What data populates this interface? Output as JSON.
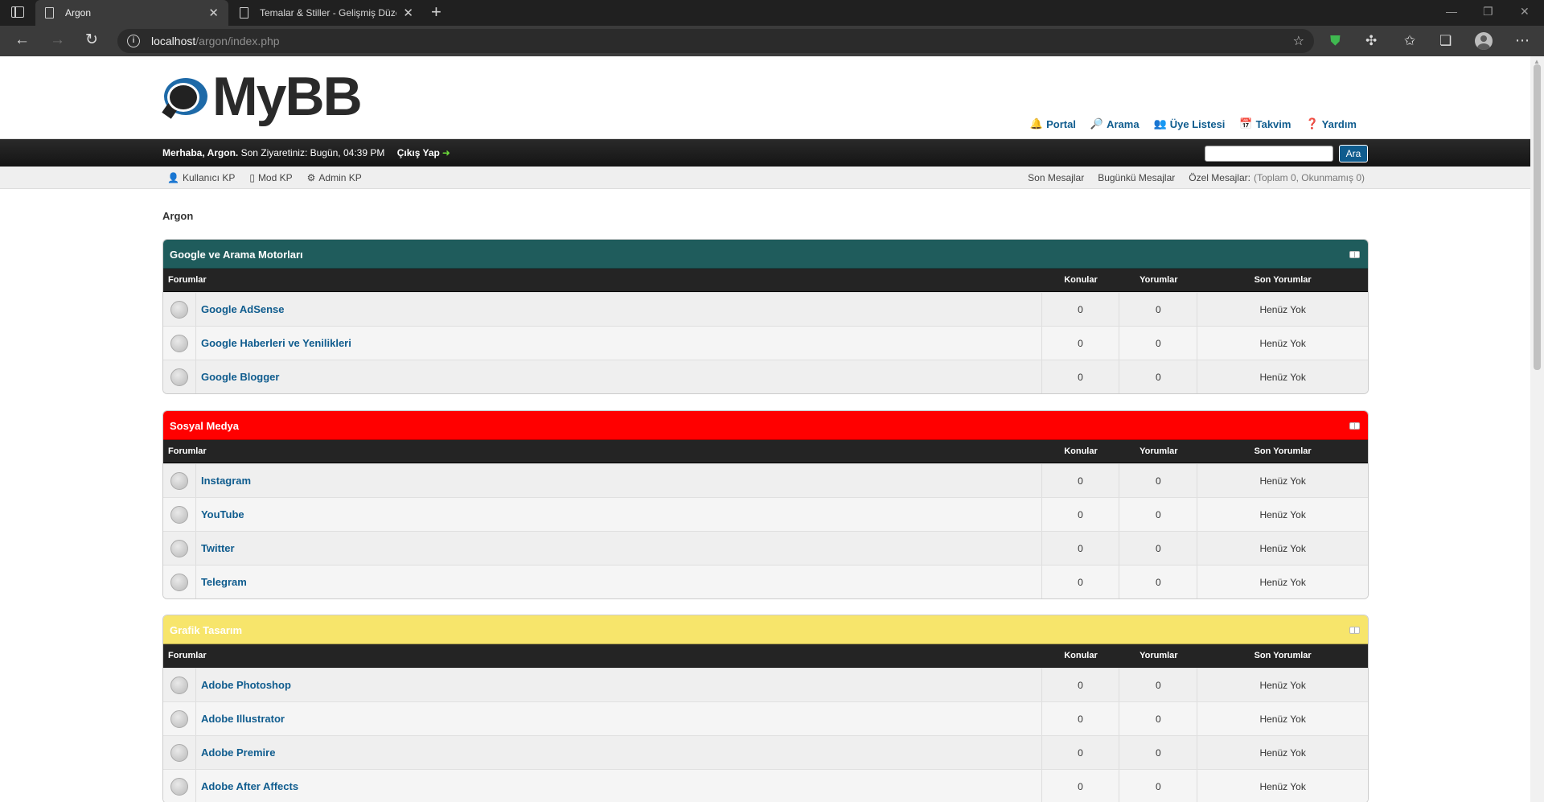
{
  "browser": {
    "tabs": [
      {
        "title": "Argon",
        "active": true
      },
      {
        "title": "Temalar & Stiller - Gelişmiş Düze",
        "active": false
      }
    ],
    "url_host": "localhost",
    "url_path": "/argon/index.php"
  },
  "header": {
    "logo_text": "MyBB",
    "top_links": [
      {
        "icon": "portal-icon",
        "glyph": "🔔",
        "label": "Portal"
      },
      {
        "icon": "search-icon",
        "glyph": "🔎",
        "label": "Arama"
      },
      {
        "icon": "members-icon",
        "glyph": "👥",
        "label": "Üye Listesi"
      },
      {
        "icon": "calendar-icon",
        "glyph": "📅",
        "label": "Takvim"
      },
      {
        "icon": "help-icon",
        "glyph": "❓",
        "label": "Yardım"
      }
    ]
  },
  "welcome": {
    "greeting": "Merhaba, Argon.",
    "last_visit": "Son Ziyaretiniz: Bugün, 04:39 PM",
    "logout": "Çıkış Yap",
    "search_button": "Ara",
    "search_placeholder": ""
  },
  "panel": {
    "left": [
      {
        "icon": "user-cp-icon",
        "glyph": "👤",
        "label": "Kullanıcı KP"
      },
      {
        "icon": "mod-cp-icon",
        "glyph": "▯",
        "label": "Mod KP"
      },
      {
        "icon": "admin-cp-icon",
        "glyph": "⚙",
        "label": "Admin KP"
      }
    ],
    "recent_posts": "Son Mesajlar",
    "todays_posts": "Bugünkü Mesajlar",
    "pm_label": "Özel Mesajlar:",
    "pm_status": "(Toplam 0, Okunmamış 0)"
  },
  "breadcrumb": "Argon",
  "columns": {
    "forum": "Forumlar",
    "threads": "Konular",
    "posts": "Yorumlar",
    "last": "Son Yorumlar"
  },
  "categories": [
    {
      "title": "Google ve Arama Motorları",
      "color": "#1f5c5c",
      "forums": [
        {
          "name": "Google AdSense",
          "threads": "0",
          "posts": "0",
          "last": "Henüz Yok"
        },
        {
          "name": "Google Haberleri ve Yenilikleri",
          "threads": "0",
          "posts": "0",
          "last": "Henüz Yok"
        },
        {
          "name": "Google Blogger",
          "threads": "0",
          "posts": "0",
          "last": "Henüz Yok"
        }
      ]
    },
    {
      "title": "Sosyal Medya",
      "color": "#ff0000",
      "forums": [
        {
          "name": "Instagram",
          "threads": "0",
          "posts": "0",
          "last": "Henüz Yok"
        },
        {
          "name": "YouTube",
          "threads": "0",
          "posts": "0",
          "last": "Henüz Yok"
        },
        {
          "name": "Twitter",
          "threads": "0",
          "posts": "0",
          "last": "Henüz Yok"
        },
        {
          "name": "Telegram",
          "threads": "0",
          "posts": "0",
          "last": "Henüz Yok"
        }
      ]
    },
    {
      "title": "Grafik Tasarım",
      "color": "#f7e56b",
      "forums": [
        {
          "name": "Adobe Photoshop",
          "threads": "0",
          "posts": "0",
          "last": "Henüz Yok"
        },
        {
          "name": "Adobe Illustrator",
          "threads": "0",
          "posts": "0",
          "last": "Henüz Yok"
        },
        {
          "name": "Adobe Premire",
          "threads": "0",
          "posts": "0",
          "last": "Henüz Yok"
        },
        {
          "name": "Adobe After Affects",
          "threads": "0",
          "posts": "0",
          "last": "Henüz Yok"
        }
      ]
    }
  ]
}
